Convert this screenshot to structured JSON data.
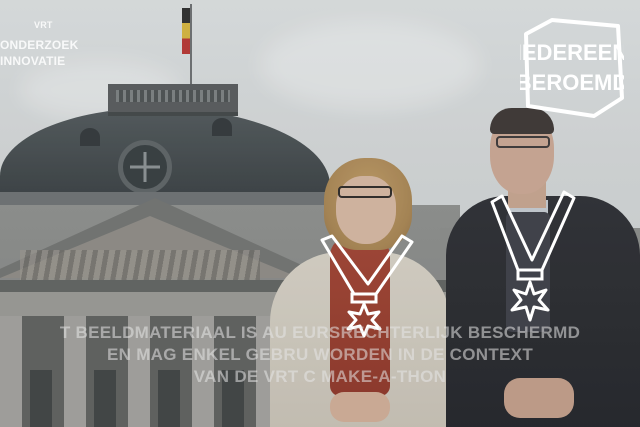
{
  "image": {
    "subject": "two-people-with-medal-drawings-in-front-of-palace"
  },
  "logos": {
    "left_top": "VRT",
    "left_line1": "ONDERZOEK",
    "left_line2": "INNOVATIE",
    "right_line1": "IEDEREEN",
    "right_line2": "BEROEMD"
  },
  "watermark": {
    "line1": "T BEELDMATERIAAL IS AU   EURSRECHTERLIJK BESCHERMD",
    "line2": "EN MAG ENKEL GEBRU    WORDEN IN DE CONTEXT",
    "line3": "VAN DE VRT C   MAKE-A-THON"
  },
  "colors": {
    "overlay_white": "#ffffff",
    "woman_scarf": "#a2402f",
    "man_coat": "#1e1f24"
  }
}
